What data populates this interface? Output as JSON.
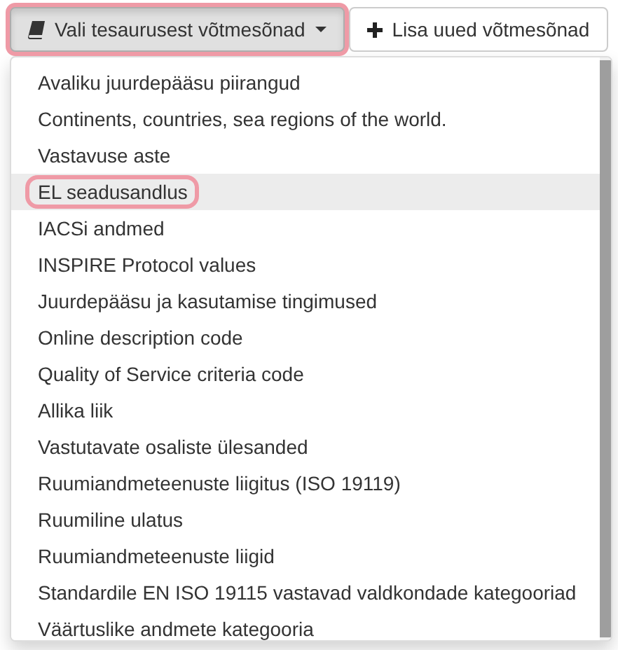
{
  "toolbar": {
    "buttons": [
      {
        "kind": "dropdown",
        "label": "Vali tesaurusest võtmesõnad",
        "pressed": true,
        "highlighted": true
      },
      {
        "kind": "add",
        "label": "Lisa uued võtmesõnad",
        "pressed": false,
        "highlighted": false
      }
    ]
  },
  "menu": {
    "items": [
      {
        "label": "Avaliku juurdepääsu piirangud",
        "hovered": false,
        "highlighted": false
      },
      {
        "label": "Continents, countries, sea regions of the world.",
        "hovered": false,
        "highlighted": false
      },
      {
        "label": "Vastavuse aste",
        "hovered": false,
        "highlighted": false
      },
      {
        "label": "EL seadusandlus",
        "hovered": true,
        "highlighted": true
      },
      {
        "label": "IACSi andmed",
        "hovered": false,
        "highlighted": false
      },
      {
        "label": "INSPIRE Protocol values",
        "hovered": false,
        "highlighted": false
      },
      {
        "label": "Juurdepääsu ja kasutamise tingimused",
        "hovered": false,
        "highlighted": false
      },
      {
        "label": "Online description code",
        "hovered": false,
        "highlighted": false
      },
      {
        "label": "Quality of Service criteria code",
        "hovered": false,
        "highlighted": false
      },
      {
        "label": "Allika liik",
        "hovered": false,
        "highlighted": false
      },
      {
        "label": "Vastutavate osaliste ülesanded",
        "hovered": false,
        "highlighted": false
      },
      {
        "label": "Ruumiandmeteenuste liigitus (ISO 19119)",
        "hovered": false,
        "highlighted": false
      },
      {
        "label": "Ruumiline ulatus",
        "hovered": false,
        "highlighted": false
      },
      {
        "label": "Ruumiandmeteenuste liigid",
        "hovered": false,
        "highlighted": false
      },
      {
        "label": "Standardile EN ISO 19115 vastavad valdkondade kategooriad",
        "hovered": false,
        "highlighted": false
      },
      {
        "label": "Väärtuslike andmete kategooria",
        "hovered": false,
        "highlighted": false
      }
    ]
  }
}
